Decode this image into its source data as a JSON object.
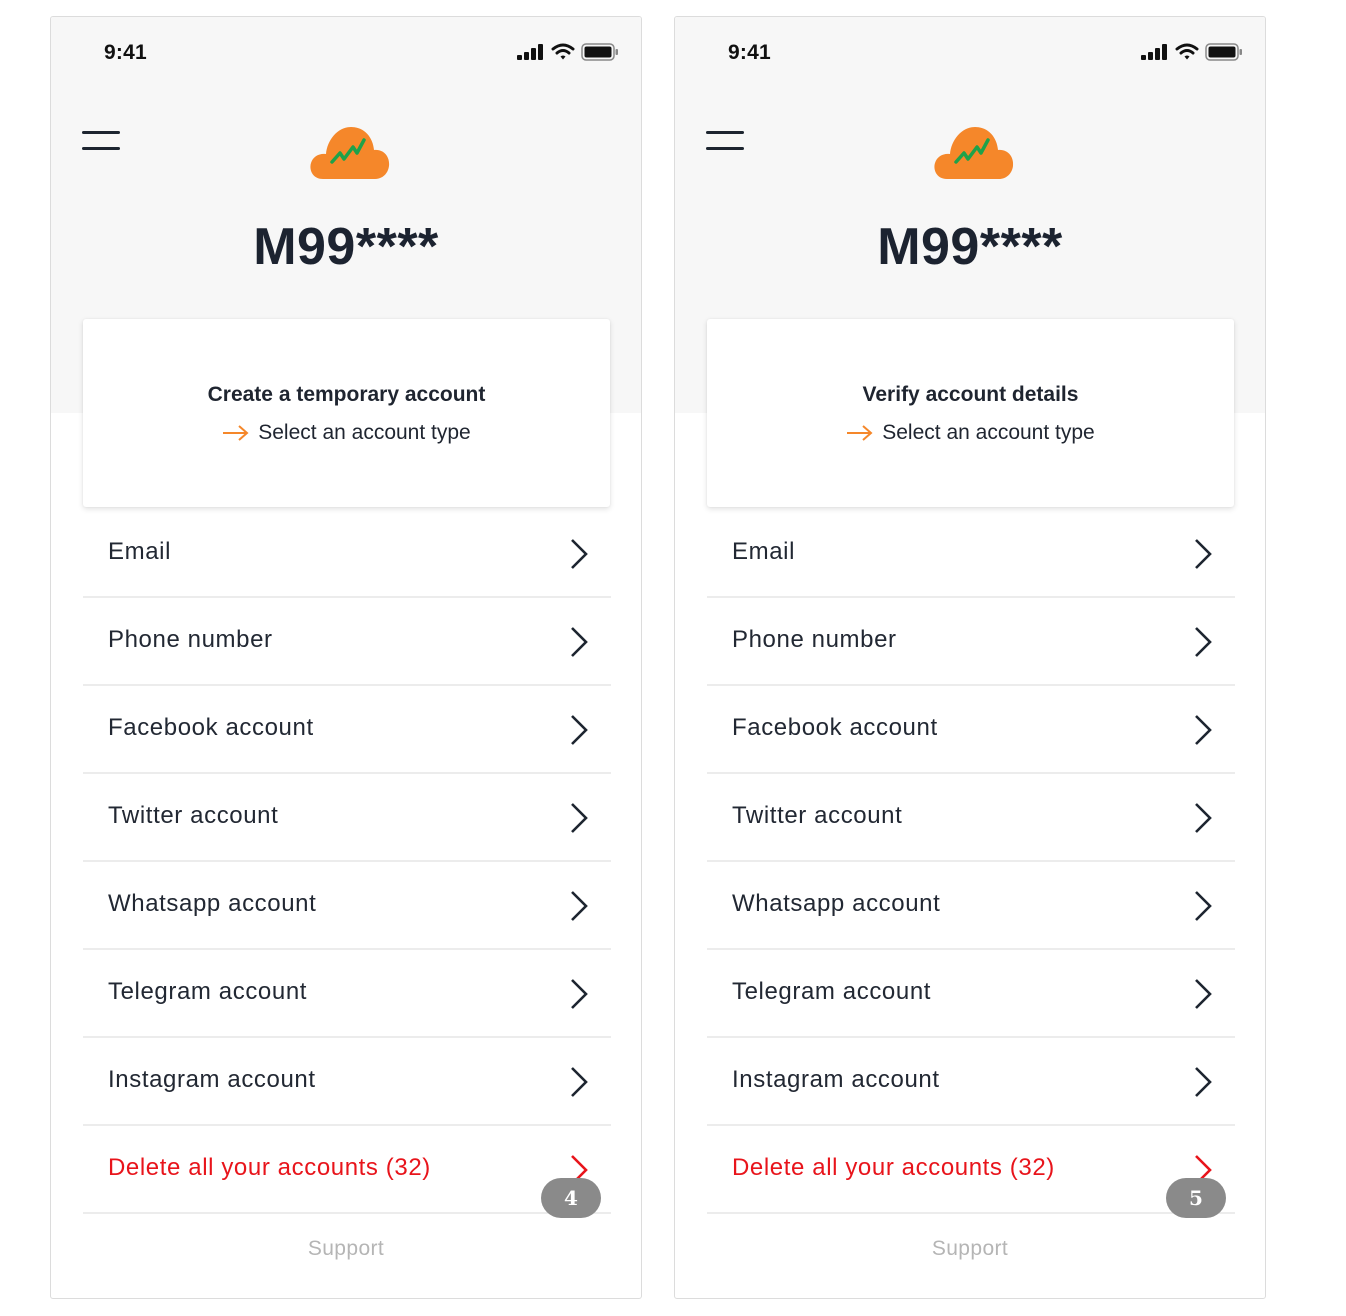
{
  "screens": [
    {
      "status": {
        "time": "9:41"
      },
      "account_id": "M99****",
      "card": {
        "title": "Create a temporary account",
        "subtitle": "Select an account type"
      },
      "rows": [
        {
          "label": "Email"
        },
        {
          "label": "Phone number"
        },
        {
          "label": "Facebook account"
        },
        {
          "label": "Twitter account"
        },
        {
          "label": "Whatsapp account"
        },
        {
          "label": "Telegram account"
        },
        {
          "label": "Instagram account"
        },
        {
          "label": "Delete all your accounts (32)"
        }
      ],
      "badge": "4",
      "support": "Support"
    },
    {
      "status": {
        "time": "9:41"
      },
      "account_id": "M99****",
      "card": {
        "title": "Verify account details",
        "subtitle": "Select an account type"
      },
      "rows": [
        {
          "label": "Email"
        },
        {
          "label": "Phone number"
        },
        {
          "label": "Facebook account"
        },
        {
          "label": "Twitter account"
        },
        {
          "label": "Whatsapp account"
        },
        {
          "label": "Telegram account"
        },
        {
          "label": "Instagram account"
        },
        {
          "label": "Delete all your accounts (32)"
        }
      ],
      "badge": "5",
      "support": "Support"
    }
  ],
  "colors": {
    "accent_orange": "#f5872a",
    "logo_chart_green": "#1ea24a",
    "danger_red": "#e8141b",
    "text_dark": "#222833",
    "header_bg": "#f7f7f7",
    "badge_gray": "#8a8a8a"
  },
  "icons": [
    "signal-icon",
    "wifi-icon",
    "battery-icon",
    "menu-icon",
    "cloud-logo-icon",
    "arrow-right-icon",
    "chevron-right-icon"
  ]
}
